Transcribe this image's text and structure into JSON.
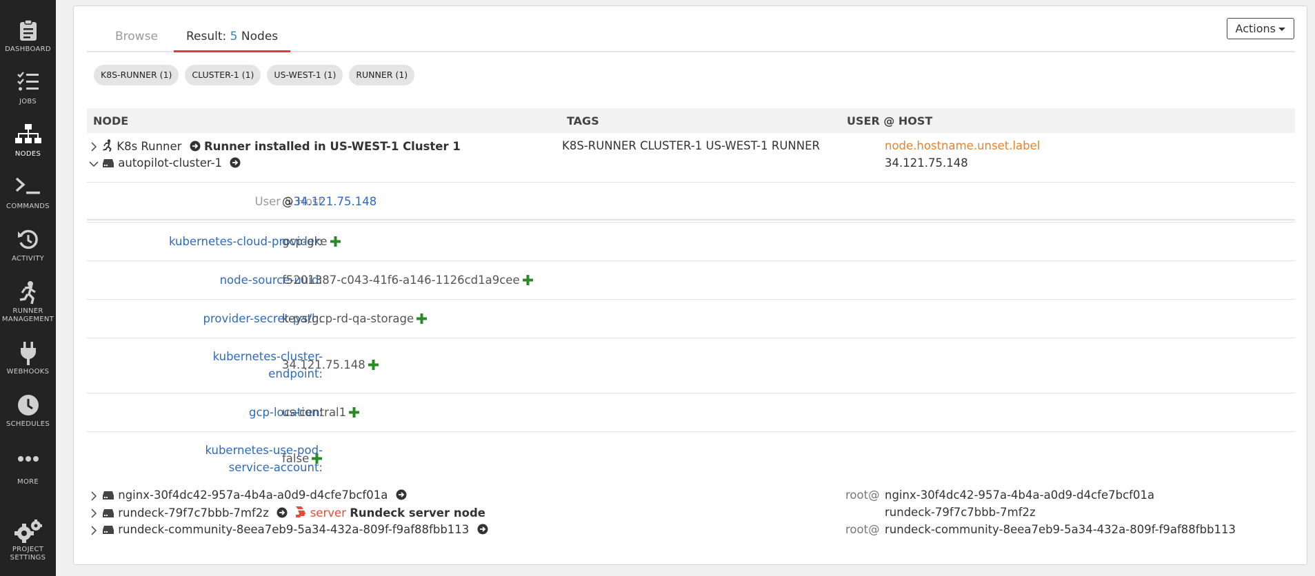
{
  "sidebar": {
    "items": [
      {
        "label": "DASHBOARD",
        "icon": "clipboard-icon"
      },
      {
        "label": "JOBS",
        "icon": "list-check-icon"
      },
      {
        "label": "NODES",
        "icon": "sitemap-icon",
        "active": true
      },
      {
        "label": "COMMANDS",
        "icon": "terminal-icon"
      },
      {
        "label": "ACTIVITY",
        "icon": "history-icon"
      },
      {
        "label": "RUNNER",
        "label2": "MANAGEMENT",
        "icon": "runner-icon"
      },
      {
        "label": "WEBHOOKS",
        "icon": "plug-icon"
      },
      {
        "label": "SCHEDULES",
        "icon": "clock-icon"
      },
      {
        "label": "MORE",
        "icon": "ellipsis-icon"
      },
      {
        "label": "PROJECT",
        "label2": "SETTINGS",
        "icon": "gears-icon"
      }
    ]
  },
  "tabs": {
    "browse": "Browse",
    "result_prefix": "Result:",
    "result_count": "5",
    "result_suffix": "Nodes"
  },
  "actions_label": "Actions",
  "filter_chips": [
    "K8S-RUNNER (1)",
    "CLUSTER-1 (1)",
    "US-WEST-1 (1)",
    "RUNNER (1)"
  ],
  "table": {
    "headers": {
      "node": "NODE",
      "tags": "TAGS",
      "user_host": "USER @ HOST"
    }
  },
  "runner_row": {
    "name": "K8s Runner",
    "description": "Runner installed in US-WEST-1 Cluster 1",
    "tags": "K8S-RUNNER CLUSTER-1 US-WEST-1 RUNNER",
    "hostname_label": "node.hostname.unset.label"
  },
  "expanded_node": {
    "name": "autopilot-cluster-1",
    "host": "34.121.75.148",
    "user_host_label": "User & Host",
    "user_host_at": "@",
    "user_host_value": "34.121.75.148",
    "attributes": [
      {
        "key": "kubernetes-cloud-provider:",
        "value": "gcp-gke"
      },
      {
        "key": "node-source-uuid:",
        "value": "f5201387-c043-41f6-a146-1126cd1a9cee"
      },
      {
        "key": "provider-secret-path:",
        "value": "keys/gcp-rd-qa-storage"
      },
      {
        "key_line1": "kubernetes-cluster-",
        "key_line2": "endpoint:",
        "value": "34.121.75.148"
      },
      {
        "key": "gcp-location:",
        "value": "us-central1"
      },
      {
        "key_line1": "kubernetes-use-pod-",
        "key_line2": "service-account:",
        "value": "false"
      }
    ]
  },
  "other_nodes": [
    {
      "name": "nginx-30f4dc42-957a-4b4a-a0d9-d4cfe7bcf01a",
      "user": "root@",
      "host": "nginx-30f4dc42-957a-4b4a-a0d9-d4cfe7bcf01a"
    },
    {
      "name": "rundeck-79f7c7bbb-7mf2z",
      "badge": "server",
      "description": "Rundeck server node",
      "user": "",
      "host": "rundeck-79f7c7bbb-7mf2z"
    },
    {
      "name": "rundeck-community-8eea7eb9-5a34-432a-809f-f9af88fbb113",
      "user": "root@",
      "host": "rundeck-community-8eea7eb9-5a34-432a-809f-f9af88fbb113"
    }
  ],
  "colors": {
    "sidebar_bg": "#232323",
    "link_blue": "#2d6ac0",
    "accent_red": "#e53935",
    "plus_green": "#2a8a2a",
    "orange": "#e8802b"
  }
}
